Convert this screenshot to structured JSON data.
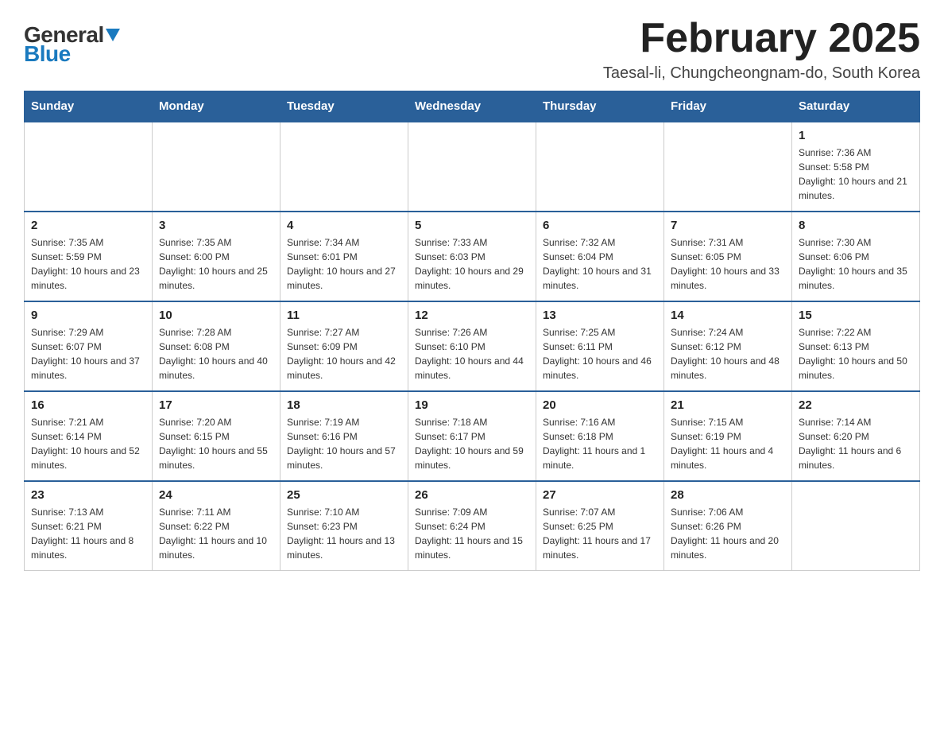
{
  "logo": {
    "general": "General",
    "blue": "Blue"
  },
  "header": {
    "title": "February 2025",
    "location": "Taesal-li, Chungcheongnam-do, South Korea"
  },
  "weekdays": [
    "Sunday",
    "Monday",
    "Tuesday",
    "Wednesday",
    "Thursday",
    "Friday",
    "Saturday"
  ],
  "weeks": [
    [
      {
        "day": "",
        "info": ""
      },
      {
        "day": "",
        "info": ""
      },
      {
        "day": "",
        "info": ""
      },
      {
        "day": "",
        "info": ""
      },
      {
        "day": "",
        "info": ""
      },
      {
        "day": "",
        "info": ""
      },
      {
        "day": "1",
        "info": "Sunrise: 7:36 AM\nSunset: 5:58 PM\nDaylight: 10 hours and 21 minutes."
      }
    ],
    [
      {
        "day": "2",
        "info": "Sunrise: 7:35 AM\nSunset: 5:59 PM\nDaylight: 10 hours and 23 minutes."
      },
      {
        "day": "3",
        "info": "Sunrise: 7:35 AM\nSunset: 6:00 PM\nDaylight: 10 hours and 25 minutes."
      },
      {
        "day": "4",
        "info": "Sunrise: 7:34 AM\nSunset: 6:01 PM\nDaylight: 10 hours and 27 minutes."
      },
      {
        "day": "5",
        "info": "Sunrise: 7:33 AM\nSunset: 6:03 PM\nDaylight: 10 hours and 29 minutes."
      },
      {
        "day": "6",
        "info": "Sunrise: 7:32 AM\nSunset: 6:04 PM\nDaylight: 10 hours and 31 minutes."
      },
      {
        "day": "7",
        "info": "Sunrise: 7:31 AM\nSunset: 6:05 PM\nDaylight: 10 hours and 33 minutes."
      },
      {
        "day": "8",
        "info": "Sunrise: 7:30 AM\nSunset: 6:06 PM\nDaylight: 10 hours and 35 minutes."
      }
    ],
    [
      {
        "day": "9",
        "info": "Sunrise: 7:29 AM\nSunset: 6:07 PM\nDaylight: 10 hours and 37 minutes."
      },
      {
        "day": "10",
        "info": "Sunrise: 7:28 AM\nSunset: 6:08 PM\nDaylight: 10 hours and 40 minutes."
      },
      {
        "day": "11",
        "info": "Sunrise: 7:27 AM\nSunset: 6:09 PM\nDaylight: 10 hours and 42 minutes."
      },
      {
        "day": "12",
        "info": "Sunrise: 7:26 AM\nSunset: 6:10 PM\nDaylight: 10 hours and 44 minutes."
      },
      {
        "day": "13",
        "info": "Sunrise: 7:25 AM\nSunset: 6:11 PM\nDaylight: 10 hours and 46 minutes."
      },
      {
        "day": "14",
        "info": "Sunrise: 7:24 AM\nSunset: 6:12 PM\nDaylight: 10 hours and 48 minutes."
      },
      {
        "day": "15",
        "info": "Sunrise: 7:22 AM\nSunset: 6:13 PM\nDaylight: 10 hours and 50 minutes."
      }
    ],
    [
      {
        "day": "16",
        "info": "Sunrise: 7:21 AM\nSunset: 6:14 PM\nDaylight: 10 hours and 52 minutes."
      },
      {
        "day": "17",
        "info": "Sunrise: 7:20 AM\nSunset: 6:15 PM\nDaylight: 10 hours and 55 minutes."
      },
      {
        "day": "18",
        "info": "Sunrise: 7:19 AM\nSunset: 6:16 PM\nDaylight: 10 hours and 57 minutes."
      },
      {
        "day": "19",
        "info": "Sunrise: 7:18 AM\nSunset: 6:17 PM\nDaylight: 10 hours and 59 minutes."
      },
      {
        "day": "20",
        "info": "Sunrise: 7:16 AM\nSunset: 6:18 PM\nDaylight: 11 hours and 1 minute."
      },
      {
        "day": "21",
        "info": "Sunrise: 7:15 AM\nSunset: 6:19 PM\nDaylight: 11 hours and 4 minutes."
      },
      {
        "day": "22",
        "info": "Sunrise: 7:14 AM\nSunset: 6:20 PM\nDaylight: 11 hours and 6 minutes."
      }
    ],
    [
      {
        "day": "23",
        "info": "Sunrise: 7:13 AM\nSunset: 6:21 PM\nDaylight: 11 hours and 8 minutes."
      },
      {
        "day": "24",
        "info": "Sunrise: 7:11 AM\nSunset: 6:22 PM\nDaylight: 11 hours and 10 minutes."
      },
      {
        "day": "25",
        "info": "Sunrise: 7:10 AM\nSunset: 6:23 PM\nDaylight: 11 hours and 13 minutes."
      },
      {
        "day": "26",
        "info": "Sunrise: 7:09 AM\nSunset: 6:24 PM\nDaylight: 11 hours and 15 minutes."
      },
      {
        "day": "27",
        "info": "Sunrise: 7:07 AM\nSunset: 6:25 PM\nDaylight: 11 hours and 17 minutes."
      },
      {
        "day": "28",
        "info": "Sunrise: 7:06 AM\nSunset: 6:26 PM\nDaylight: 11 hours and 20 minutes."
      },
      {
        "day": "",
        "info": ""
      }
    ]
  ]
}
